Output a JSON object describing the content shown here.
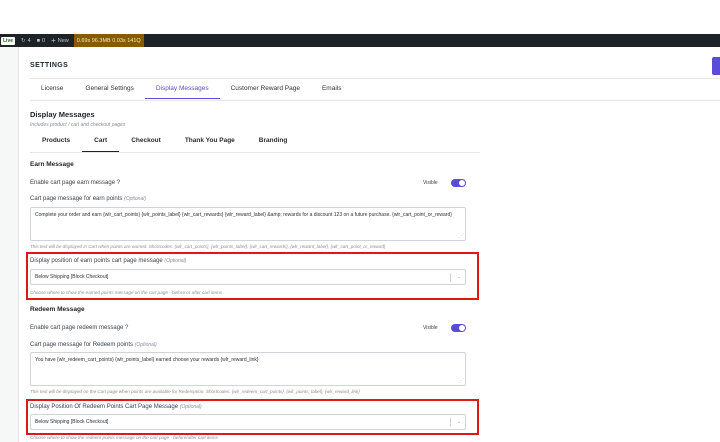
{
  "adminbar": {
    "live": "Live",
    "sync_count": "4",
    "comments_count": "0",
    "new_label": "New",
    "perf": "0.69s  96.3MB  0.03s  141Q"
  },
  "settings_heading": "SETTINGS",
  "main_tabs": [
    "License",
    "General Settings",
    "Display Messages",
    "Customer Reward Page",
    "Emails"
  ],
  "display_messages": {
    "title": "Display Messages",
    "subtitle": "Includes product / cart and checkout pages"
  },
  "sub_tabs": [
    "Products",
    "Cart",
    "Checkout",
    "Thank You Page",
    "Branding"
  ],
  "earn": {
    "heading": "Earn Message",
    "enable_label": "Enable cart page earn message ?",
    "visible_label": "Visible",
    "message_label": "Cart page message for earn points",
    "optional": "(Optional)",
    "message_value": "Complete your order and earn {wlr_cart_points} {wlr_points_label} {wlr_cart_rewards} {wlr_reward_label} &amp; rewards for a discount 123 on a future purchase. {wlr_cart_point_or_reward}",
    "message_help": "This text will be displayed in Cart when points are earned. Shortcodes: {wlr_cart_points}, {wlr_points_label}, {wlr_cart_rewards}, {wlr_reward_label}, {wlr_cart_point_or_reward}",
    "position_label": "Display position of earn points cart page message",
    "position_value": "Below Shipping [Block Checkout]",
    "position_help": "Choose where to show the earned points message on the cart page - before or after cart items"
  },
  "redeem": {
    "heading": "Redeem Message",
    "enable_label": "Enable cart page redeem message ?",
    "visible_label": "Visible",
    "message_label": "Cart page message for Redeem points",
    "optional": "(Optional)",
    "message_value": "You have {wlr_redeem_cart_points} {wlr_points_label} earned choose your rewards {wlr_reward_link}",
    "message_help": "This text will be displayed on the Cart page when points are available for Redemption. Shortcodes: {wlr_redeem_cart_points}, {wlr_points_label}, {wlr_reward_link}",
    "position_label": "Display Position Of Redeem Points Cart Page Message",
    "position_value": "Below Shipping [Block Checkout]",
    "position_help": "Choose where to show the redeem points message on the cart page - before/after cart items"
  },
  "colors": {
    "accent": "#5b4bdb",
    "highlight": "#e01717",
    "adminbar": "#1d2327"
  }
}
